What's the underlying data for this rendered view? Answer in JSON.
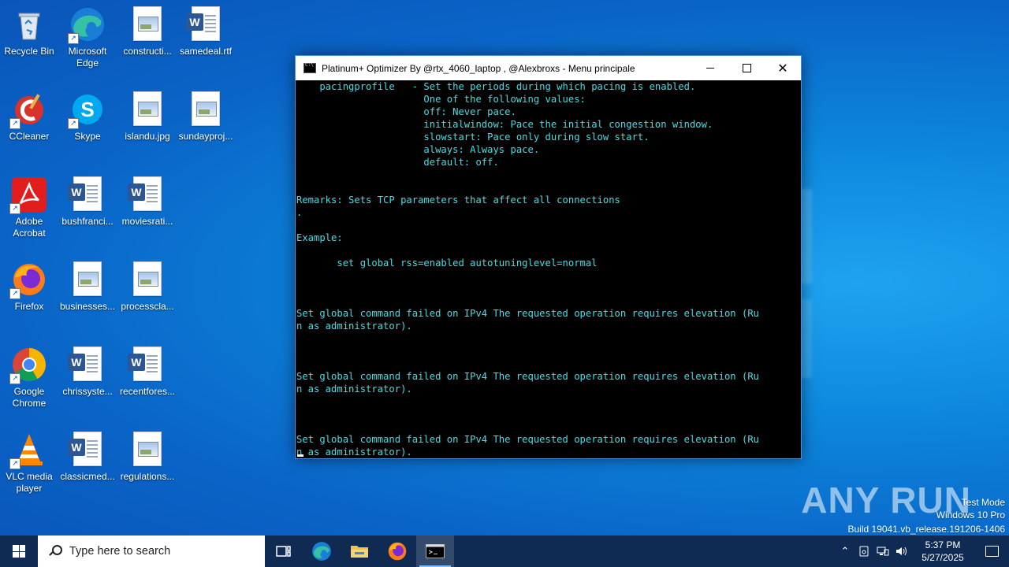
{
  "desktop": {
    "icons": [
      {
        "label": "Recycle Bin"
      },
      {
        "label": "Microsoft Edge"
      },
      {
        "label": "constructi..."
      },
      {
        "label": "samedeal.rtf"
      },
      {
        "label": "CCleaner"
      },
      {
        "label": "Skype"
      },
      {
        "label": "islandu.jpg"
      },
      {
        "label": "sundayproj..."
      },
      {
        "label": "Adobe Acrobat"
      },
      {
        "label": "bushfranci..."
      },
      {
        "label": "moviesrati..."
      },
      {
        "label": "Firefox"
      },
      {
        "label": "businesses..."
      },
      {
        "label": "processcla..."
      },
      {
        "label": "Google Chrome"
      },
      {
        "label": "chrissyste..."
      },
      {
        "label": "recentfores..."
      },
      {
        "label": "VLC media player"
      },
      {
        "label": "classicmed..."
      },
      {
        "label": "regulations..."
      }
    ]
  },
  "window": {
    "title": "Platinum+ Optimizer By @rtx_4060_laptop , @Alexbroxs - Menu principale",
    "console_text": "    pacingprofile   - Set the periods during which pacing is enabled.\n                      One of the following values:\n                      off: Never pace.\n                      initialwindow: Pace the initial congestion window.\n                      slowstart: Pace only during slow start.\n                      always: Always pace.\n                      default: off.\n\n\nRemarks: Sets TCP parameters that affect all connections\n.\n\nExample:\n\n       set global rss=enabled autotuninglevel=normal\n\n\n\nSet global command failed on IPv4 The requested operation requires elevation (Ru\nn as administrator).\n\n\n\nSet global command failed on IPv4 The requested operation requires elevation (Ru\nn as administrator).\n\n\n\nSet global command failed on IPv4 The requested operation requires elevation (Ru\nn as administrator)."
  },
  "watermark": {
    "brand": "ANY RUN",
    "line1": "Test Mode",
    "line2": "Windows 10 Pro",
    "line3": "Build 19041.vb_release.191206-1406"
  },
  "taskbar": {
    "search_placeholder": "Type here to search",
    "time": "5:37 PM",
    "date": "5/27/2025"
  },
  "colors": {
    "console_text": "#3de0e3",
    "taskbar": "#0f2b53"
  }
}
